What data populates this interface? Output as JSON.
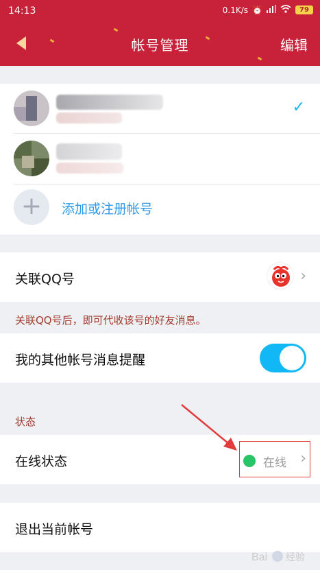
{
  "status_bar": {
    "time": "14:13",
    "network_speed": "0.1K/s",
    "battery_level": "79"
  },
  "nav": {
    "title": "帐号管理",
    "edit_label": "编辑",
    "back_icon": "back-arrow-icon"
  },
  "accounts": {
    "items": [
      {
        "selected": true
      },
      {
        "selected": false
      }
    ],
    "add_label": "添加或注册帐号"
  },
  "settings": {
    "linked_qq_label": "关联QQ号",
    "linked_qq_hint": "关联QQ号后，即可代收该号的好友消息。",
    "other_account_alerts_label": "我的其他帐号消息提醒",
    "other_account_alerts_enabled": true
  },
  "status_section": {
    "header": "状态",
    "online_status_label": "在线状态",
    "online_status_value": "在线",
    "online_color": "#27c468"
  },
  "logout": {
    "label": "退出当前帐号"
  },
  "colors": {
    "brand_red": "#c8223a",
    "toggle_blue": "#12b7f5",
    "link_blue": "#2f9be8",
    "hint_red": "#a33a2e",
    "highlight": "#e23b3b"
  }
}
